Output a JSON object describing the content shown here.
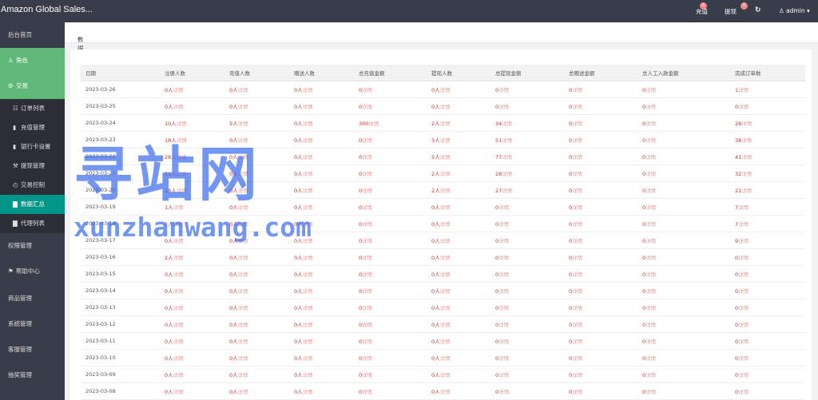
{
  "header": {
    "title": "Amazon Global Sales...",
    "recharge_label": "充值",
    "recharge_badge": "0",
    "withdraw_label": "提现",
    "withdraw_badge": "0",
    "refresh_icon": "refresh-icon",
    "user_label": "admin"
  },
  "sidebar": {
    "items": [
      {
        "label": "后台首页",
        "type": "top"
      },
      {
        "label": "角色",
        "type": "top",
        "icon": "user-icon"
      },
      {
        "label": "交易",
        "type": "top",
        "icon": "gear-icon"
      },
      {
        "label": "订单列表",
        "type": "sub",
        "icon": "cart-icon"
      },
      {
        "label": "充值管理",
        "type": "sub",
        "icon": "card-icon"
      },
      {
        "label": "银行卡设置",
        "type": "sub",
        "icon": "card-icon"
      },
      {
        "label": "提现管理",
        "type": "sub",
        "icon": "wrench-icon"
      },
      {
        "label": "交易控制",
        "type": "sub",
        "icon": "gauge-icon"
      },
      {
        "label": "数据汇总",
        "type": "sub",
        "icon": "chart-icon"
      },
      {
        "label": "代理列表",
        "type": "sub",
        "icon": "chart-icon"
      },
      {
        "label": "权限管理",
        "type": "top"
      },
      {
        "label": "帮助中心",
        "type": "top",
        "icon": "flag-icon"
      },
      {
        "label": "商品管理",
        "type": "top"
      },
      {
        "label": "系统管理",
        "type": "top"
      },
      {
        "label": "客服管理",
        "type": "top"
      },
      {
        "label": "抽奖管理",
        "type": "top"
      }
    ]
  },
  "breadcrumb": "数据汇总",
  "table": {
    "columns": [
      "日期",
      "注册人数",
      "充值人数",
      "赠送人数",
      "总充值金额",
      "提现人数",
      "总提现金额",
      "总赠送金额",
      "总人工入款金额",
      "完成订单数"
    ],
    "detail_label": "详情",
    "rows": [
      [
        "2023-03-26",
        "0人",
        "0人",
        "0人",
        "0",
        "0人",
        "0",
        "0",
        "0",
        "1"
      ],
      [
        "2023-03-25",
        "0人",
        "0人",
        "0人",
        "0",
        "0人",
        "0",
        "0",
        "0",
        "0"
      ],
      [
        "2023-03-24",
        "10人",
        "5人",
        "0人",
        "300",
        "2人",
        "34",
        "0",
        "0",
        "28"
      ],
      [
        "2023-03-23",
        "18人",
        "0人",
        "0人",
        "0",
        "3人",
        "51",
        "0",
        "0",
        "38"
      ],
      [
        "2023-03-22",
        "28人",
        "0人",
        "0人",
        "0",
        "5人",
        "77",
        "0",
        "0",
        "41"
      ],
      [
        "2023-03-21",
        "21人",
        "0人",
        "0人",
        "0",
        "2人",
        "28",
        "0",
        "0",
        "32"
      ],
      [
        "2023-03-20",
        "18人",
        "0人",
        "0人",
        "0",
        "2人",
        "27",
        "0",
        "0",
        "21"
      ],
      [
        "2023-03-19",
        "1人",
        "0人",
        "0人",
        "0",
        "0人",
        "0",
        "0",
        "0",
        "7"
      ],
      [
        "2023-03-18",
        "1人",
        "0人",
        "0人",
        "0",
        "0人",
        "0",
        "0",
        "0",
        "7"
      ],
      [
        "2023-03-17",
        "0人",
        "0人",
        "0人",
        "0",
        "0人",
        "0",
        "0",
        "0",
        "9"
      ],
      [
        "2023-03-16",
        "2人",
        "0人",
        "0人",
        "0",
        "0人",
        "0",
        "0",
        "0",
        "0"
      ],
      [
        "2023-03-15",
        "0人",
        "0人",
        "0人",
        "0",
        "0人",
        "0",
        "0",
        "0",
        "0"
      ],
      [
        "2023-03-14",
        "0人",
        "0人",
        "0人",
        "0",
        "0人",
        "0",
        "0",
        "0",
        "0"
      ],
      [
        "2023-03-13",
        "0人",
        "0人",
        "0人",
        "0",
        "0人",
        "0",
        "0",
        "0",
        "0"
      ],
      [
        "2023-03-12",
        "0人",
        "0人",
        "0人",
        "0",
        "0人",
        "0",
        "0",
        "0",
        "0"
      ],
      [
        "2023-03-11",
        "0人",
        "0人",
        "0人",
        "0",
        "0人",
        "0",
        "0",
        "0",
        "0"
      ],
      [
        "2023-03-10",
        "0人",
        "0人",
        "0人",
        "0",
        "0人",
        "0",
        "0",
        "0",
        "0"
      ],
      [
        "2023-03-09",
        "0人",
        "0人",
        "0人",
        "0",
        "0人",
        "0",
        "0",
        "0",
        "0"
      ],
      [
        "2023-03-08",
        "0人",
        "0人",
        "0人",
        "0",
        "0人",
        "0",
        "0",
        "0",
        "0"
      ]
    ]
  },
  "watermark": {
    "cn": "寻站网",
    "en": "xunzhanwang.com"
  },
  "colors": {
    "topbar": "#393d49",
    "sidebar": "#393d49",
    "active_green": "#5fb878",
    "value_red": "#c9302c",
    "watermark_blue": "#3c6eeb"
  }
}
